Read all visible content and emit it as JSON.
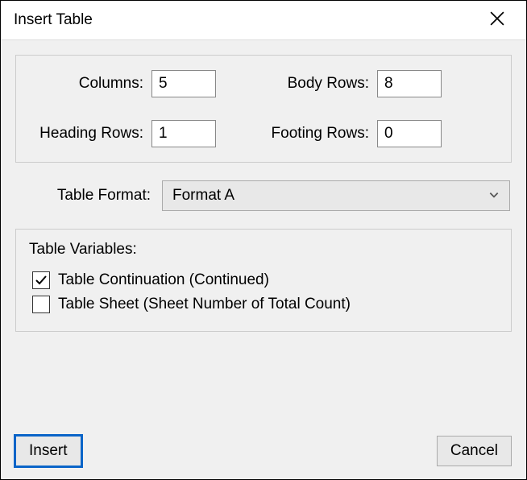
{
  "title": "Insert Table",
  "fields": {
    "columns_label": "Columns:",
    "columns_value": "5",
    "body_rows_label": "Body Rows:",
    "body_rows_value": "8",
    "heading_rows_label": "Heading Rows:",
    "heading_rows_value": "1",
    "footing_rows_label": "Footing Rows:",
    "footing_rows_value": "0"
  },
  "format": {
    "label": "Table Format:",
    "value": "Format A"
  },
  "variables": {
    "title": "Table Variables:",
    "continuation_label": "Table Continuation (Continued)",
    "continuation_checked": true,
    "sheet_label": "Table Sheet (Sheet Number of Total Count)",
    "sheet_checked": false
  },
  "buttons": {
    "insert": "Insert",
    "cancel": "Cancel"
  }
}
